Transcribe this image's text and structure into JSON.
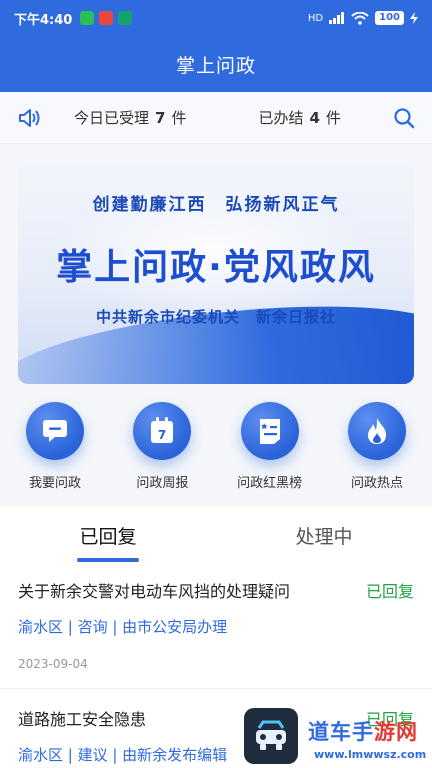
{
  "status_bar": {
    "time": "下午4:40",
    "network": "HD",
    "battery": "100"
  },
  "app_bar": {
    "title": "掌上问政"
  },
  "info_bar": {
    "received_label": "今日已受理",
    "received_count": "7",
    "received_unit": "件",
    "done_label": "已办结",
    "done_count": "4",
    "done_unit": "件"
  },
  "banner": {
    "line1": "创建勤廉江西　弘扬新风正气",
    "title": "掌上问政·党风政风",
    "line3": "中共新余市纪委机关　新余日报社"
  },
  "quick_actions": [
    {
      "label": "我要问政",
      "icon": "message-icon"
    },
    {
      "label": "问政周报",
      "icon": "calendar-icon"
    },
    {
      "label": "问政红黑榜",
      "icon": "list-board-icon"
    },
    {
      "label": "问政热点",
      "icon": "flame-icon"
    }
  ],
  "tabs": [
    {
      "label": "已回复",
      "active": true
    },
    {
      "label": "处理中",
      "active": false
    }
  ],
  "items": [
    {
      "title": "关于新余交警对电动车风挡的处理疑问",
      "status": "已回复",
      "meta": "渝水区 | 咨询 | 由市公安局办理",
      "date": "2023-09-04"
    },
    {
      "title": "道路施工安全隐患",
      "status": "已回复",
      "meta": "渝水区 | 建议 | 由新余发布编辑"
    }
  ],
  "watermark": {
    "title_a": "道车手",
    "title_b": "游网",
    "url": "www.lmwwsz.com"
  },
  "colors": {
    "primary": "#2f6bdf",
    "replied": "#23a245"
  }
}
